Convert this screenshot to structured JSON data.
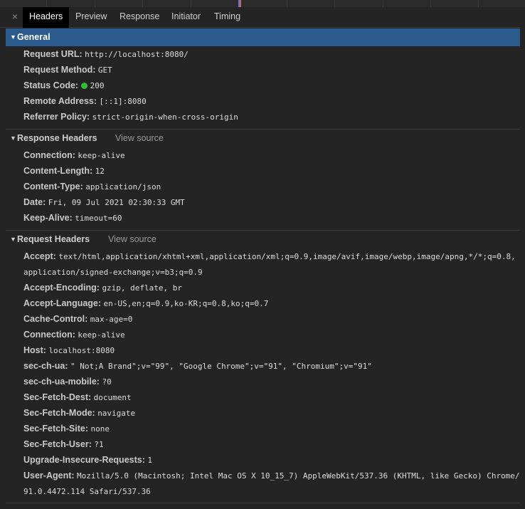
{
  "tabs": [
    "Headers",
    "Preview",
    "Response",
    "Initiator",
    "Timing"
  ],
  "close_glyph": "×",
  "general": {
    "title": "General",
    "rows": [
      {
        "key": "Request URL:",
        "value": "http://localhost:8080/"
      },
      {
        "key": "Request Method:",
        "value": "GET"
      },
      {
        "key": "Status Code:",
        "value": "200",
        "status_color": "#2fbf3a"
      },
      {
        "key": "Remote Address:",
        "value": "[::1]:8080"
      },
      {
        "key": "Referrer Policy:",
        "value": "strict-origin-when-cross-origin"
      }
    ]
  },
  "response_headers": {
    "title": "Response Headers",
    "view_source": "View source",
    "rows": [
      {
        "key": "Connection:",
        "value": "keep-alive"
      },
      {
        "key": "Content-Length:",
        "value": "12"
      },
      {
        "key": "Content-Type:",
        "value": "application/json"
      },
      {
        "key": "Date:",
        "value": "Fri, 09 Jul 2021 02:30:33 GMT"
      },
      {
        "key": "Keep-Alive:",
        "value": "timeout=60"
      }
    ]
  },
  "request_headers": {
    "title": "Request Headers",
    "view_source": "View source",
    "accept_key": "Accept:",
    "accept_value_1": "text/html,application/xhtml+xml,application/xml;q=0.9,image/avif,image/webp,image/apng,*/*;q=0.8,",
    "accept_value_2": "application/signed-exchange;v=b3;q=0.9",
    "rows": [
      {
        "key": "Accept-Encoding:",
        "value": "gzip, deflate, br"
      },
      {
        "key": "Accept-Language:",
        "value": "en-US,en;q=0.9,ko-KR;q=0.8,ko;q=0.7"
      },
      {
        "key": "Cache-Control:",
        "value": "max-age=0"
      },
      {
        "key": "Connection:",
        "value": "keep-alive"
      },
      {
        "key": "Host:",
        "value": "localhost:8080"
      },
      {
        "key": "sec-ch-ua:",
        "value": "\" Not;A Brand\";v=\"99\", \"Google Chrome\";v=\"91\", \"Chromium\";v=\"91\""
      },
      {
        "key": "sec-ch-ua-mobile:",
        "value": "?0"
      },
      {
        "key": "Sec-Fetch-Dest:",
        "value": "document"
      },
      {
        "key": "Sec-Fetch-Mode:",
        "value": "navigate"
      },
      {
        "key": "Sec-Fetch-Site:",
        "value": "none"
      },
      {
        "key": "Sec-Fetch-User:",
        "value": "?1"
      },
      {
        "key": "Upgrade-Insecure-Requests:",
        "value": "1"
      }
    ],
    "ua_key": "User-Agent:",
    "ua_value_1": "Mozilla/5.0 (Macintosh; Intel Mac OS X 10_15_7) AppleWebKit/537.36 (KHTML, like Gecko) Chrome/",
    "ua_value_2": "91.0.4472.114 Safari/537.36"
  },
  "colors": {
    "general_header_bg": "#2b5a8c",
    "status_ok": "#2fbf3a",
    "panel_bg": "#242424"
  }
}
